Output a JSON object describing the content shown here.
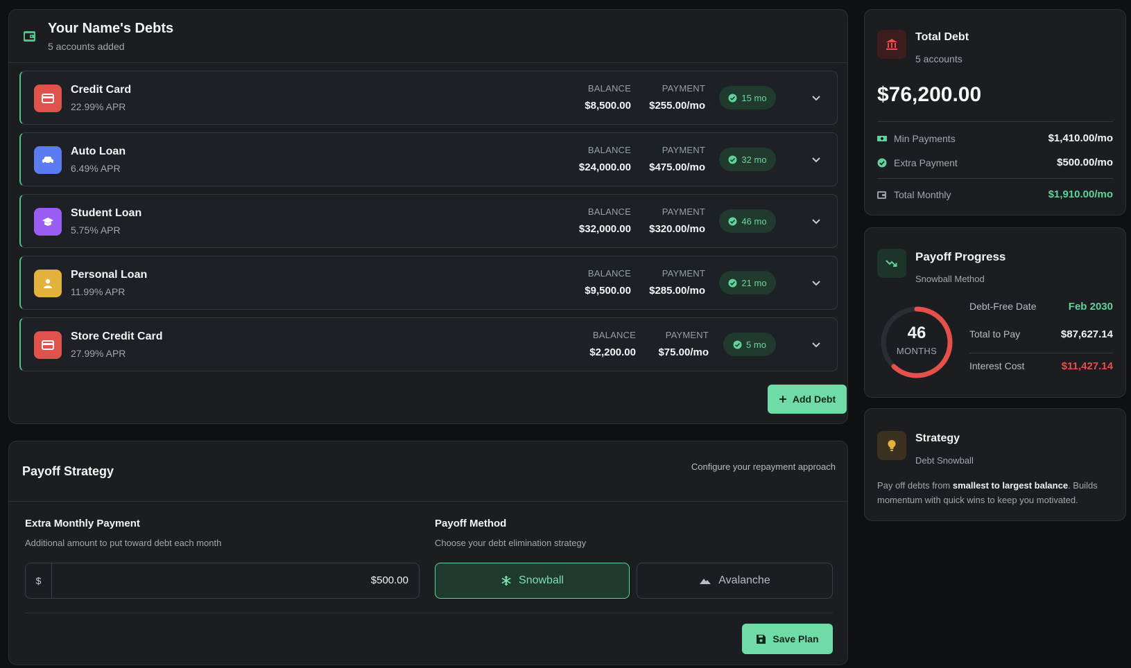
{
  "debts_panel": {
    "title": "Your Name's Debts",
    "subtitle": "5 accounts added",
    "balance_label": "BALANCE",
    "payment_label": "PAYMENT",
    "add_debt_label": "Add Debt",
    "items": [
      {
        "name": "Credit Card",
        "apr": "22.99% APR",
        "balance": "$8,500.00",
        "payment": "$255.00/mo",
        "months": "15 mo",
        "icon": "credit-card-icon",
        "color": "#e0524c"
      },
      {
        "name": "Auto Loan",
        "apr": "6.49% APR",
        "balance": "$24,000.00",
        "payment": "$475.00/mo",
        "months": "32 mo",
        "icon": "car-icon",
        "color": "#5a7cf0"
      },
      {
        "name": "Student Loan",
        "apr": "5.75% APR",
        "balance": "$32,000.00",
        "payment": "$320.00/mo",
        "months": "46 mo",
        "icon": "graduation-cap-icon",
        "color": "#9a5cf2"
      },
      {
        "name": "Personal Loan",
        "apr": "11.99% APR",
        "balance": "$9,500.00",
        "payment": "$285.00/mo",
        "months": "21 mo",
        "icon": "user-icon",
        "color": "#e3b23c"
      },
      {
        "name": "Store Credit Card",
        "apr": "27.99% APR",
        "balance": "$2,200.00",
        "payment": "$75.00/mo",
        "months": "5 mo",
        "icon": "credit-card-icon",
        "color": "#e0524c"
      }
    ]
  },
  "strategy_panel": {
    "title": "Payoff Strategy",
    "hint": "Configure your repayment approach",
    "extra_title": "Extra Monthly Payment",
    "extra_desc": "Additional amount to put toward debt each month",
    "currency_symbol": "$",
    "extra_value": "$500.00",
    "method_title": "Payoff Method",
    "method_desc": "Choose your debt elimination strategy",
    "snowball_label": "Snowball",
    "avalanche_label": "Avalanche",
    "save_label": "Save Plan"
  },
  "total_panel": {
    "title": "Total Debt",
    "subtitle": "5 accounts",
    "amount": "$76,200.00",
    "min_label": "Min Payments",
    "min_value": "$1,410.00/mo",
    "extra_label": "Extra Payment",
    "extra_value": "$500.00/mo",
    "monthly_label": "Total Monthly",
    "monthly_value": "$1,910.00/mo"
  },
  "progress_panel": {
    "title": "Payoff Progress",
    "subtitle": "Snowball Method",
    "months": "46",
    "months_label": "MONTHS",
    "date_label": "Debt-Free Date",
    "date_value": "Feb 2030",
    "total_label": "Total to Pay",
    "total_value": "$87,627.14",
    "interest_label": "Interest Cost",
    "interest_value": "$11,427.14",
    "ring_progress": 0.62
  },
  "tip_panel": {
    "title": "Strategy",
    "subtitle": "Debt Snowball",
    "text_pre": "Pay off debts from ",
    "text_bold": "smallest to largest balance",
    "text_post": ". Builds momentum with quick wins to keep you motivated."
  },
  "colors": {
    "accent": "#6fdba6",
    "danger": "#e5504a",
    "success_text": "#5fd39a"
  }
}
